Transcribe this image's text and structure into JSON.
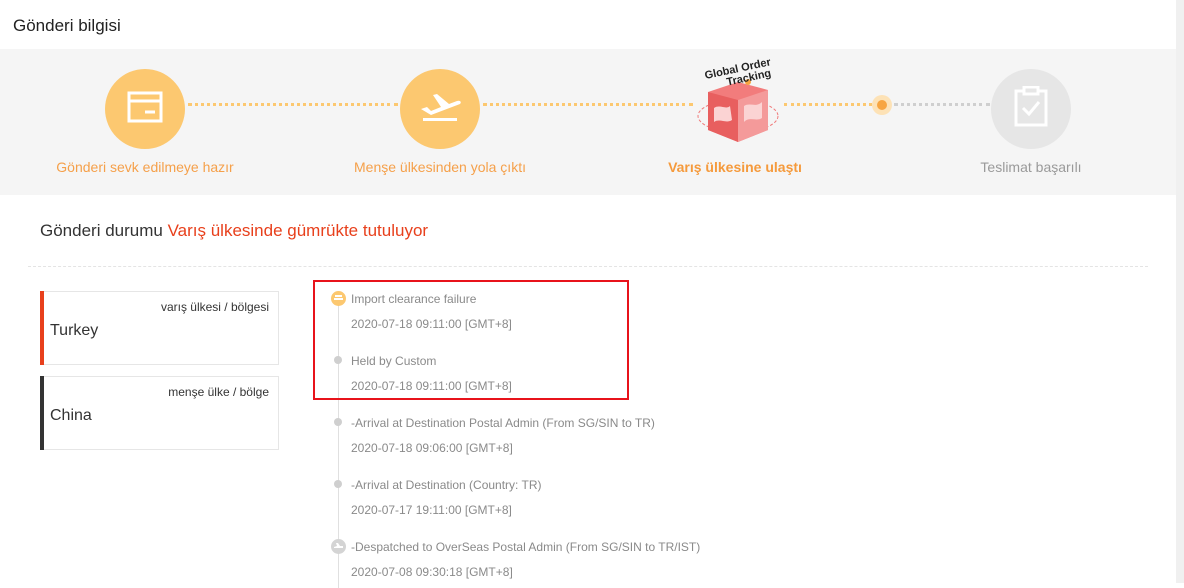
{
  "header": {
    "title": "Gönderi bilgisi"
  },
  "steps": [
    {
      "label": "Gönderi sevk edilmeye hazır",
      "icon": "package-icon",
      "state": "done"
    },
    {
      "label": "Menşe ülkesinden yola çıktı",
      "icon": "plane-departure-icon",
      "state": "done"
    },
    {
      "label": "Varış ülkesine ulaştı",
      "icon": "global-order-tracking-logo",
      "state": "current"
    },
    {
      "label": "Teslimat başarılı",
      "icon": "clipboard-check-icon",
      "state": "todo"
    }
  ],
  "logo": {
    "line1": "Global Order",
    "line2": "Tracking"
  },
  "status": {
    "prefix": "Gönderi durumu",
    "value": "Varış ülkesinde gümrükte tutuluyor"
  },
  "countries": {
    "destination": {
      "caption": "varış ülkesi / bölgesi",
      "name": "Turkey"
    },
    "origin": {
      "caption": "menşe ülke / bölge",
      "name": "China"
    }
  },
  "timeline": [
    {
      "title": "Import clearance failure",
      "time": "2020-07-18 09:11:00 [GMT+8]",
      "icon": "customs-icon"
    },
    {
      "title": "Held by Custom",
      "time": "2020-07-18 09:11:00 [GMT+8]",
      "icon": "dot"
    },
    {
      "title": "-Arrival at Destination Postal Admin (From SG/SIN to TR)",
      "time": "2020-07-18 09:06:00 [GMT+8]",
      "icon": "dot"
    },
    {
      "title": "-Arrival at Destination (Country: TR)",
      "time": "2020-07-17 19:11:00 [GMT+8]",
      "icon": "dot"
    },
    {
      "title": "-Despatched to OverSeas Postal Admin (From SG/SIN to TR/IST)",
      "time": "2020-07-08 09:30:18 [GMT+8]",
      "icon": "plane-icon"
    }
  ],
  "colors": {
    "accent": "#f5a04a",
    "highlight": "#e8401c",
    "destination_bar": "#e8401c",
    "origin_bar": "#333333",
    "annotation_box": "#e8131b"
  }
}
